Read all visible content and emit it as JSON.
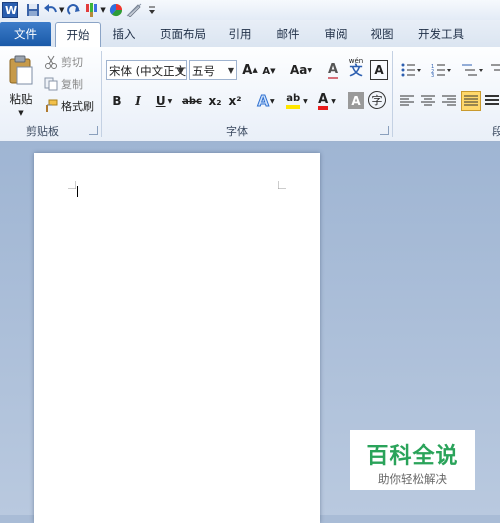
{
  "quick_access": {
    "icons": [
      "word-logo-icon",
      "save-icon",
      "undo-icon",
      "redo-icon",
      "format-brush-icon",
      "color-circle-icon",
      "pen-icon",
      "customize-icon"
    ]
  },
  "tabs": {
    "file": "文件",
    "home": "开始",
    "insert": "插入",
    "layout": "页面布局",
    "references": "引用",
    "mailings": "邮件",
    "review": "审阅",
    "view": "视图",
    "developer": "开发工具"
  },
  "clipboard": {
    "paste": "粘贴",
    "cut": "剪切",
    "copy": "复制",
    "format_painter": "格式刷",
    "group": "剪贴板"
  },
  "font": {
    "font_name": "宋体 (中文正文",
    "font_size": "五号",
    "grow": "A",
    "shrink": "A",
    "case": "Aa",
    "clear": "A",
    "phonetic": "wén",
    "border": "A",
    "bold": "B",
    "italic": "I",
    "underline": "U",
    "strike": "abc",
    "subscript": "x₂",
    "superscript": "x²",
    "text_effect": "A",
    "highlight": "ab",
    "font_color": "A",
    "shading": "A",
    "enclose": "字",
    "group": "字体"
  },
  "paragraph": {
    "group_partial": "段"
  },
  "watermark": {
    "title": "百科全说",
    "subtitle": "助你轻松解决"
  },
  "colors": {
    "file_tab": "#1a5aa8",
    "highlight_yellow": "#ffe600",
    "font_red": "#e81c1c",
    "badge_green": "#2aa35a"
  }
}
